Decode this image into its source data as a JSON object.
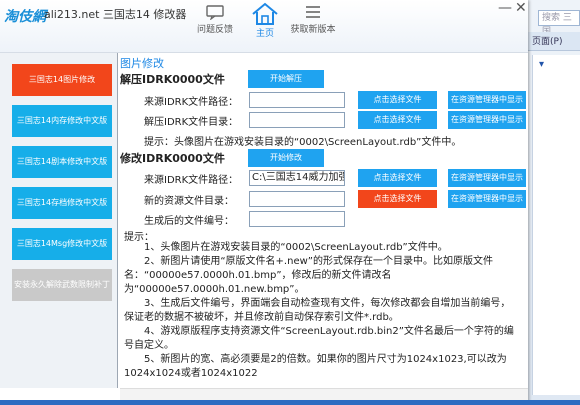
{
  "titlebar": {
    "logo": "淘伎網",
    "title": "ali213.net 三国志14 修改器",
    "tools": [
      {
        "label": "问题反馈",
        "icon": "feedback-icon"
      },
      {
        "label": "主页",
        "icon": "home-icon"
      },
      {
        "label": "获取新版本",
        "icon": "list-icon"
      }
    ],
    "controls": {
      "minimize": "—",
      "close": "✕"
    }
  },
  "sidebar": {
    "items": [
      {
        "label": "三国志14图片修改",
        "state": "active"
      },
      {
        "label": "三国志14内存修改中文版",
        "state": "normal"
      },
      {
        "label": "三国志14剧本修改中文版",
        "state": "normal"
      },
      {
        "label": "三国志14存档修改中文版",
        "state": "normal"
      },
      {
        "label": "三国志14Msg修改中文版",
        "state": "normal"
      },
      {
        "label": "安装永久解除武数限制补丁",
        "state": "disabled"
      }
    ]
  },
  "main": {
    "header": "图片修改",
    "decompress": {
      "title": "解压IDRK0000文件",
      "start_button": "开始解压",
      "src_label": "来源IDRK文件路径：",
      "src_value": "",
      "dst_label": "解压IDRK文件目录：",
      "dst_value": "",
      "choose_label": "点击选择文件",
      "show_label": "在资源管理器中显示",
      "hint": "提示：头像图片在游戏安装目录的“0002\\ScreenLayout.rdb”文件中。"
    },
    "modify": {
      "title": "修改IDRK0000文件",
      "start_button": "开始修改",
      "src_label": "来源IDRK文件路径：",
      "src_value": "C:\\三国志14威力加强",
      "res_label": "新的资源文件目录：",
      "res_value": "",
      "num_label": "生成后的文件编号：",
      "num_value": "",
      "choose_label": "点击选择文件",
      "show_label": "在资源管理器中显示"
    },
    "tips": {
      "title": "提示：",
      "lines": [
        "1、头像图片在游戏安装目录的“0002\\ScreenLayout.rdb”文件中。",
        "2、新图片请使用“原版文件名+.new”的形式保存在一个目录中。比如原版文件名：“00000e57.0000h.01.bmp”，修改后的新文件请改名为“00000e57.0000h.01.new.bmp”。",
        "3、生成后文件编号，界面端会自动检查现有文件，每次修改都会自增加当前编号，保证老的数据不被破坏，并且修改前自动保存索引文件*.rdb。",
        "4、游戏原版程序支持资源文件“ScreenLayout.rdb.bin2”文件名最后一个字符的编号自定义。",
        "5、新图片的宽、高必须要是2的倍数。如果你的图片尺寸为1024x1023,可以改为1024x1024或者1024x1022"
      ]
    }
  },
  "desktop": {
    "search": "搜索 三国",
    "tab": "页面(P)"
  },
  "colors": {
    "accent": "#1fa3f0",
    "active": "#f2461b",
    "disabled": "#c9c9c9"
  }
}
